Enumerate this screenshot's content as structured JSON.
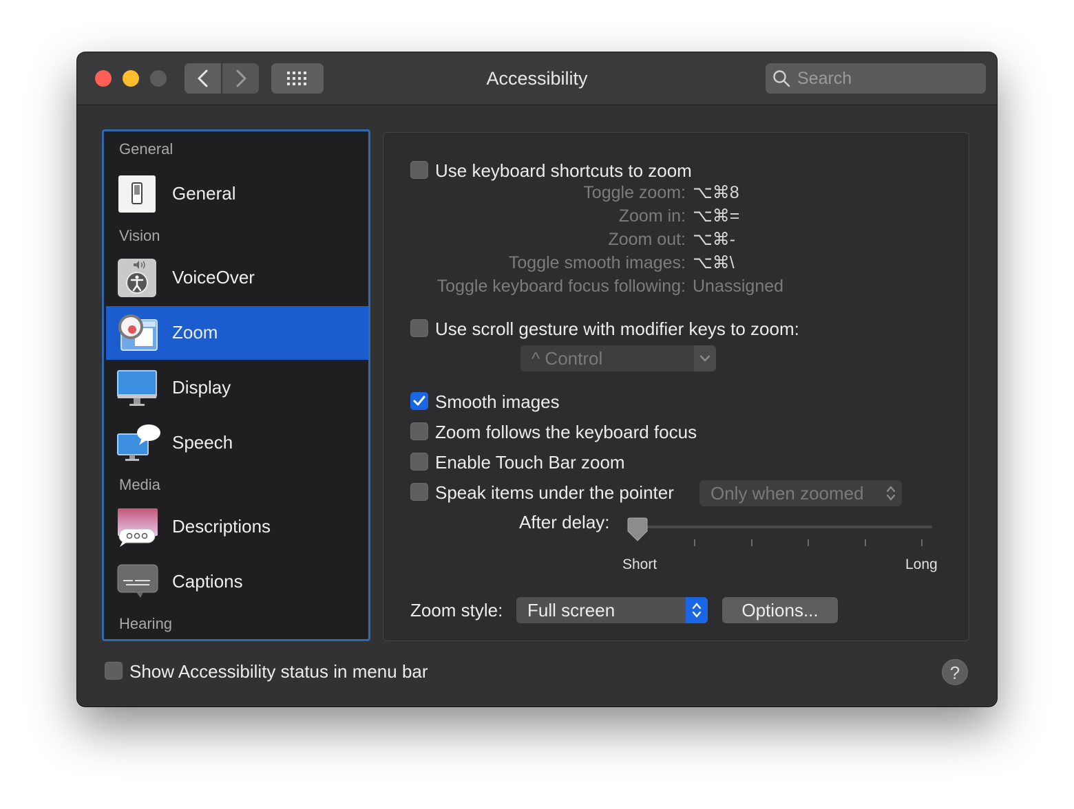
{
  "window": {
    "title": "Accessibility"
  },
  "search": {
    "placeholder": "Search"
  },
  "sidebar": {
    "headers": {
      "general": "General",
      "vision": "Vision",
      "media": "Media",
      "hearing": "Hearing"
    },
    "items": [
      {
        "label": "General",
        "icon": "switch-icon"
      },
      {
        "label": "VoiceOver",
        "icon": "voiceover-icon"
      },
      {
        "label": "Zoom",
        "icon": "zoom-icon",
        "selected": true
      },
      {
        "label": "Display",
        "icon": "display-icon"
      },
      {
        "label": "Speech",
        "icon": "speech-icon"
      },
      {
        "label": "Descriptions",
        "icon": "descriptions-icon"
      },
      {
        "label": "Captions",
        "icon": "captions-icon"
      }
    ]
  },
  "zoom": {
    "keyboard_shortcuts": {
      "label": "Use keyboard shortcuts to zoom",
      "checked": false,
      "rows": [
        {
          "name": "Toggle zoom:",
          "value": "⌥⌘8"
        },
        {
          "name": "Zoom in:",
          "value": "⌥⌘="
        },
        {
          "name": "Zoom out:",
          "value": "⌥⌘-"
        },
        {
          "name": "Toggle smooth images:",
          "value": "⌥⌘\\"
        },
        {
          "name": "Toggle keyboard focus following:",
          "value": "Unassigned"
        }
      ]
    },
    "scroll_gesture": {
      "label": "Use scroll gesture with modifier keys to zoom:",
      "checked": false,
      "modifier": "^ Control"
    },
    "smooth_images": {
      "label": "Smooth images",
      "checked": true
    },
    "follow_focus": {
      "label": "Zoom follows the keyboard focus",
      "checked": false
    },
    "touch_bar": {
      "label": "Enable Touch Bar zoom",
      "checked": false
    },
    "speak_items": {
      "label": "Speak items under the pointer",
      "checked": false,
      "mode": "Only when zoomed"
    },
    "delay": {
      "label": "After delay:",
      "min_label": "Short",
      "max_label": "Long",
      "value": 0
    },
    "style": {
      "label": "Zoom style:",
      "value": "Full screen",
      "options_button": "Options..."
    }
  },
  "footer": {
    "status_menu": {
      "label": "Show Accessibility status in menu bar",
      "checked": false
    },
    "help": "?"
  },
  "colors": {
    "accent": "#1b5ccf",
    "checkbox_checked": "#1a66e4",
    "sidebar_focus": "#2f6aae"
  }
}
